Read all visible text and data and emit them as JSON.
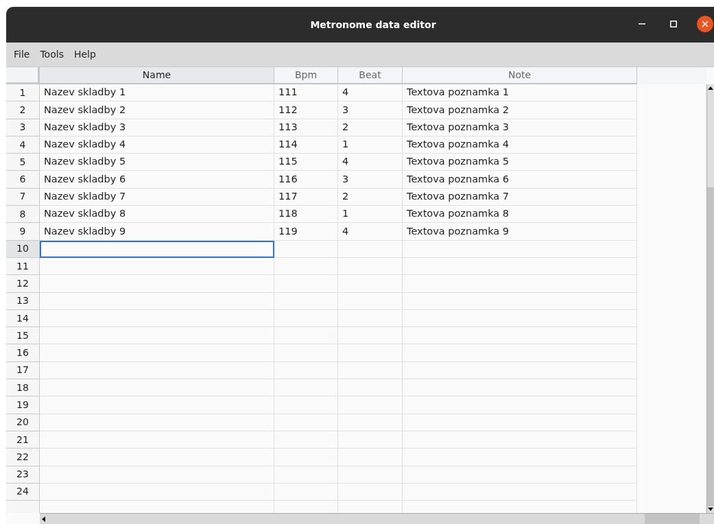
{
  "window": {
    "title": "Metronome data editor"
  },
  "menu": [
    "File",
    "Tools",
    "Help"
  ],
  "table": {
    "columns": [
      {
        "label": "Name",
        "selected": true
      },
      {
        "label": "Bpm",
        "selected": false
      },
      {
        "label": "Beat",
        "selected": false
      },
      {
        "label": "Note",
        "selected": false
      }
    ],
    "rows": [
      {
        "number": "1",
        "selected": false,
        "cells": [
          "Nazev skladby 1",
          "111",
          "4",
          "Textova poznamka 1"
        ]
      },
      {
        "number": "2",
        "selected": false,
        "cells": [
          "Nazev skladby 2",
          "112",
          "3",
          "Textova poznamka 2"
        ]
      },
      {
        "number": "3",
        "selected": false,
        "cells": [
          "Nazev skladby 3",
          "113",
          "2",
          "Textova poznamka 3"
        ]
      },
      {
        "number": "4",
        "selected": false,
        "cells": [
          "Nazev skladby 4",
          "114",
          "1",
          "Textova poznamka 4"
        ]
      },
      {
        "number": "5",
        "selected": false,
        "cells": [
          "Nazev skladby 5",
          "115",
          "4",
          "Textova poznamka 5"
        ]
      },
      {
        "number": "6",
        "selected": false,
        "cells": [
          "Nazev skladby 6",
          "116",
          "3",
          "Textova poznamka 6"
        ]
      },
      {
        "number": "7",
        "selected": false,
        "cells": [
          "Nazev skladby 7",
          "117",
          "2",
          "Textova poznamka 7"
        ]
      },
      {
        "number": "8",
        "selected": false,
        "cells": [
          "Nazev skladby 8",
          "118",
          "1",
          "Textova poznamka 8"
        ]
      },
      {
        "number": "9",
        "selected": false,
        "cells": [
          "Nazev skladby 9",
          "119",
          "4",
          "Textova poznamka 9"
        ]
      },
      {
        "number": "10",
        "selected": true
      },
      {
        "number": "11",
        "selected": false
      },
      {
        "number": "12",
        "selected": false
      },
      {
        "number": "13",
        "selected": false
      },
      {
        "number": "14",
        "selected": false
      },
      {
        "number": "15",
        "selected": false
      },
      {
        "number": "16",
        "selected": false
      },
      {
        "number": "17",
        "selected": false
      },
      {
        "number": "18",
        "selected": false
      },
      {
        "number": "19",
        "selected": false
      },
      {
        "number": "20",
        "selected": false
      },
      {
        "number": "21",
        "selected": false
      },
      {
        "number": "22",
        "selected": false
      },
      {
        "number": "23",
        "selected": false
      },
      {
        "number": "24",
        "selected": false
      },
      {
        "selected": false
      }
    ]
  }
}
